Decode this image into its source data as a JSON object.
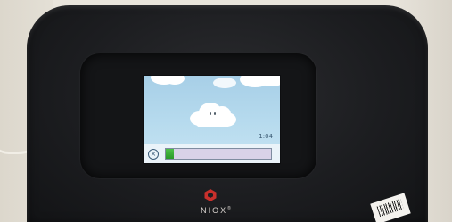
{
  "device": {
    "brand": "NIOX",
    "brand_mark": "®"
  },
  "screen": {
    "timer": "1:04",
    "progress": 0.08,
    "cancel_icon": "close-circle-icon",
    "colors": {
      "sky": "#b7dbee",
      "progress": "#3bb038",
      "progress_track": "#d9d2e8"
    }
  }
}
